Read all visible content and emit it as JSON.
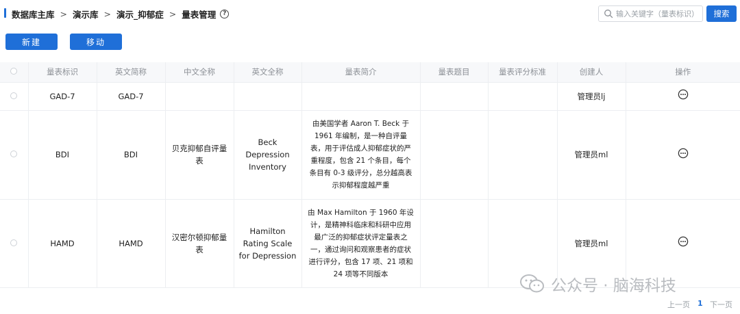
{
  "breadcrumb": {
    "items": [
      "数据库主库",
      "演示库",
      "演示_抑郁症",
      "量表管理"
    ],
    "separator": ">"
  },
  "help_icon": "question-circle-icon",
  "search": {
    "placeholder": "输入关键字（量表标识）",
    "value": "",
    "button_label": "搜索"
  },
  "toolbar": {
    "new_label": "新建",
    "move_label": "移动"
  },
  "table": {
    "columns": [
      "",
      "量表标识",
      "英文简称",
      "中文全称",
      "英文全称",
      "量表简介",
      "量表题目",
      "量表评分标准",
      "创建人",
      "操作"
    ],
    "rows": [
      {
        "id": "GAD-7",
        "en_short": "GAD-7",
        "cn_full": "",
        "en_full": "",
        "intro": "",
        "questions": "",
        "scoring": "",
        "creator": "管理员lj"
      },
      {
        "id": "BDI",
        "en_short": "BDI",
        "cn_full": "贝克抑郁自评量表",
        "en_full": "Beck Depression Inventory",
        "intro": "由美国学者 Aaron T. Beck 于 1961 年编制，是一种自评量表，用于评估成人抑郁症状的严重程度，包含 21 个条目，每个条目有 0-3 级评分，总分越高表示抑郁程度越严重",
        "questions": "",
        "scoring": "",
        "creator": "管理员ml"
      },
      {
        "id": "HAMD",
        "en_short": "HAMD",
        "cn_full": "汉密尔顿抑郁量表",
        "en_full": "Hamilton Rating Scale for Depression",
        "intro": "由 Max Hamilton 于 1960 年设计，是精神科临床和科研中应用最广泛的抑郁症状评定量表之一，通过询问和观察患者的症状进行评分，包含 17 项、21 项和 24 项等不同版本",
        "questions": "",
        "scoring": "",
        "creator": "管理员ml"
      }
    ],
    "action_icon": "more-circle-icon"
  },
  "pagination": {
    "prev_label": "上一页",
    "current_page": "1",
    "next_label": "下一页"
  },
  "watermark": {
    "text": "公众号 · 脑海科技",
    "icon": "wechat-icon"
  },
  "colors": {
    "primary": "#1f6fd8",
    "header_bg": "#f7f8fa",
    "border": "#eceef1",
    "muted_text": "#8c9096"
  }
}
